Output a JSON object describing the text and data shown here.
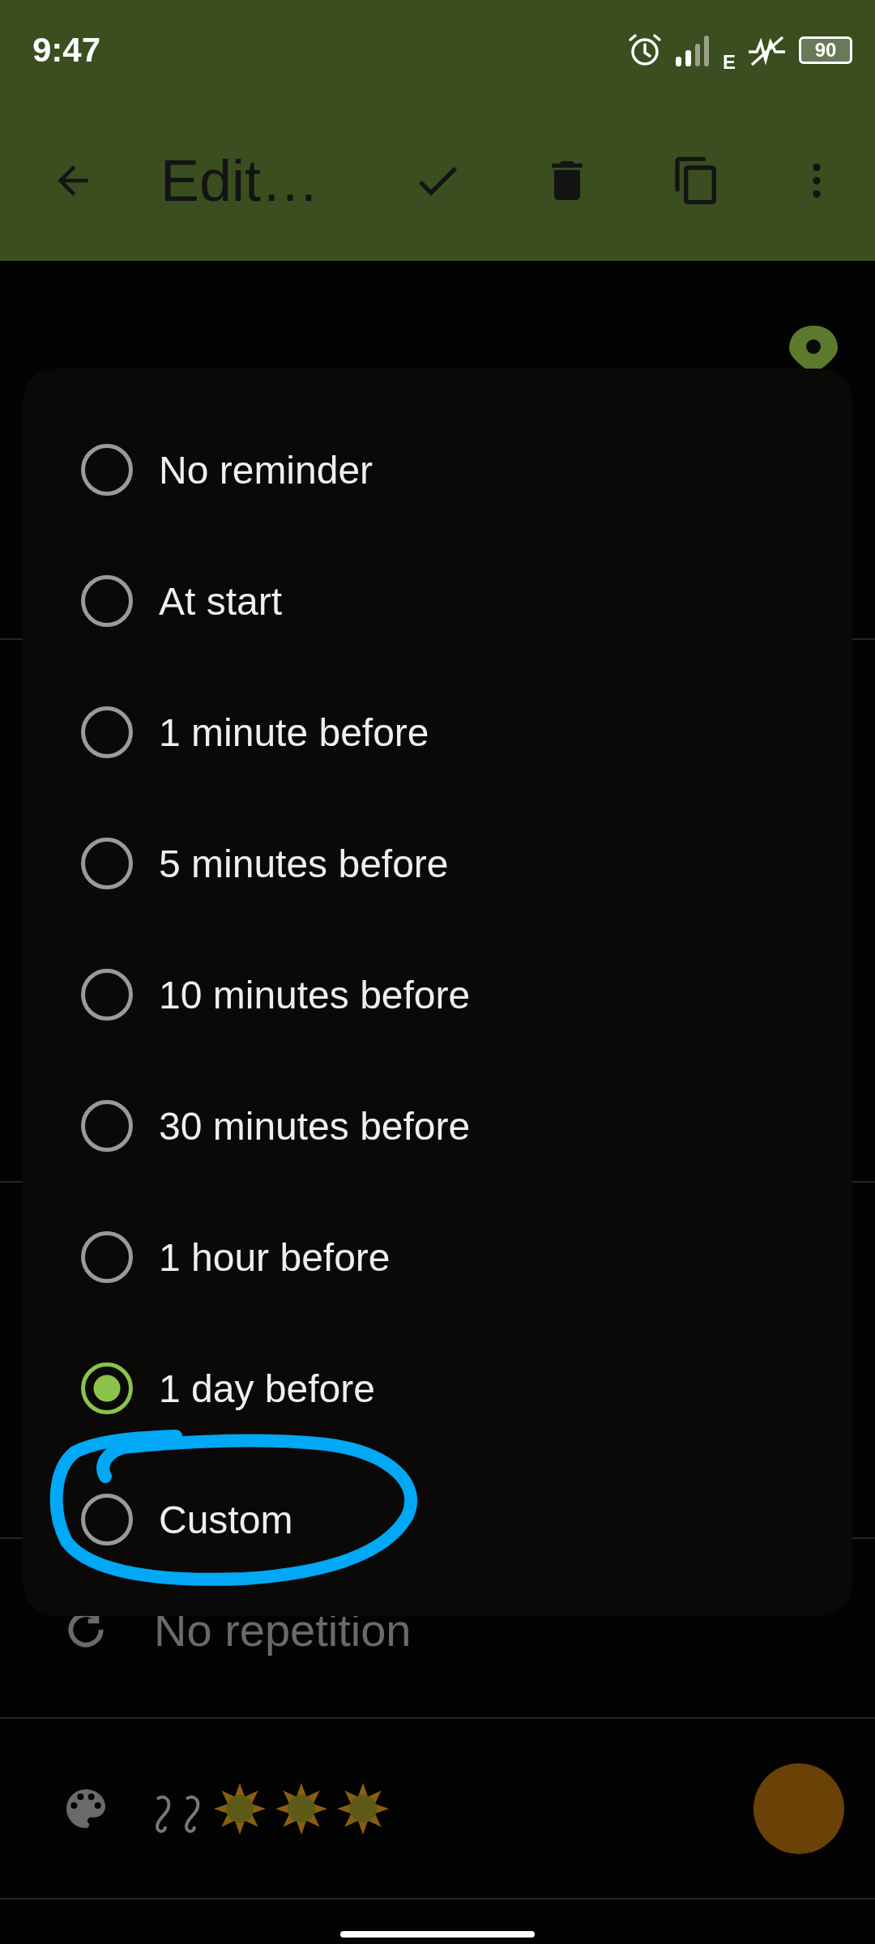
{
  "status_bar": {
    "time": "9:47",
    "network": "E",
    "battery": "90"
  },
  "toolbar": {
    "title": "Edit…"
  },
  "form": {
    "repetition": "No repetition"
  },
  "dialog": {
    "options": [
      {
        "label": "No reminder",
        "selected": false
      },
      {
        "label": "At start",
        "selected": false
      },
      {
        "label": "1 minute before",
        "selected": false
      },
      {
        "label": "5 minutes before",
        "selected": false
      },
      {
        "label": "10 minutes before",
        "selected": false
      },
      {
        "label": "30 minutes before",
        "selected": false
      },
      {
        "label": "1 hour before",
        "selected": false
      },
      {
        "label": "1 day before",
        "selected": true
      },
      {
        "label": "Custom",
        "selected": false
      }
    ]
  }
}
